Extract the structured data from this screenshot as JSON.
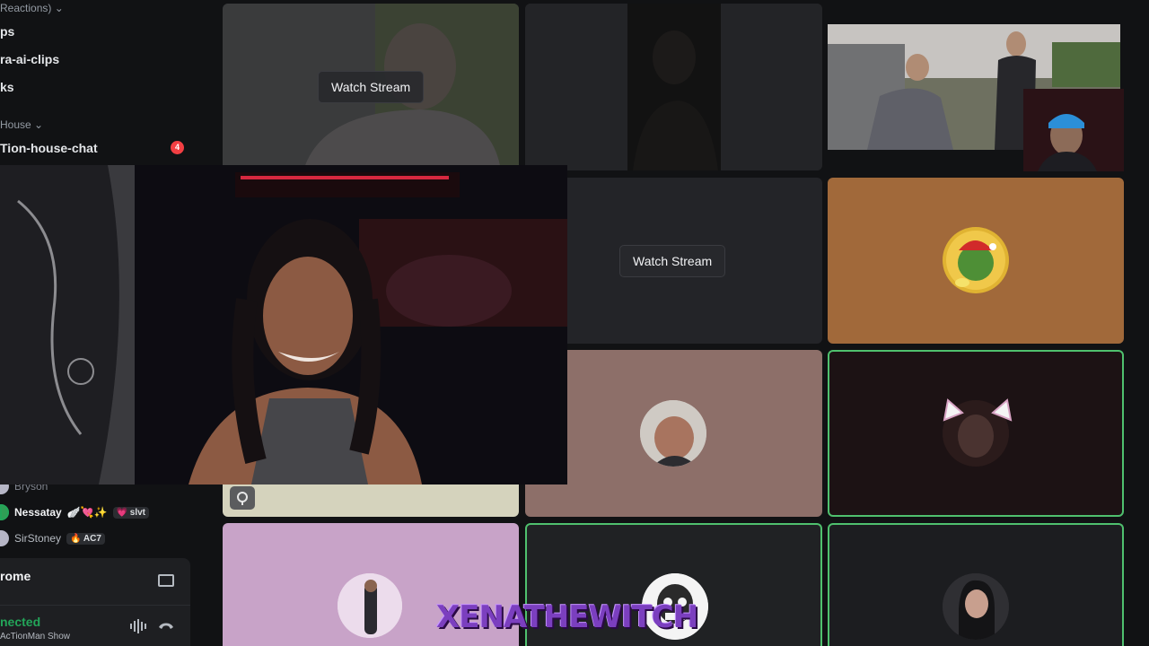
{
  "sidebar": {
    "top_category": "Reactions)",
    "channels_top": [
      "ps",
      "ra-ai-clips",
      "ks"
    ],
    "house_category": "House",
    "house_channel": "Tion-house-chat",
    "house_badge": "4",
    "members": [
      {
        "name": "Bryson",
        "tag": ""
      },
      {
        "name": "Nessatay",
        "tag": "slvt",
        "emoji": "🪽💘✨"
      },
      {
        "name": "SirStoney",
        "tag": "AC7"
      }
    ],
    "voice_title": "rome",
    "voice_status": "nected",
    "voice_sub": "AcTionMan Show"
  },
  "tiles": {
    "watch_label_1": "Watch Stream",
    "watch_label_2": "Watch Stream"
  },
  "overlay": {
    "streamer_tag": "XENATHEWITCH"
  },
  "colors": {
    "speaking_border": "#4fc06e",
    "tile_orange": "#a1693a",
    "tile_mauve": "#8d6f69",
    "tile_lilac": "#c8a3c8",
    "tile_beige": "#d5d3bd",
    "badge_red": "#f23f43",
    "connected_green": "#23a559"
  }
}
